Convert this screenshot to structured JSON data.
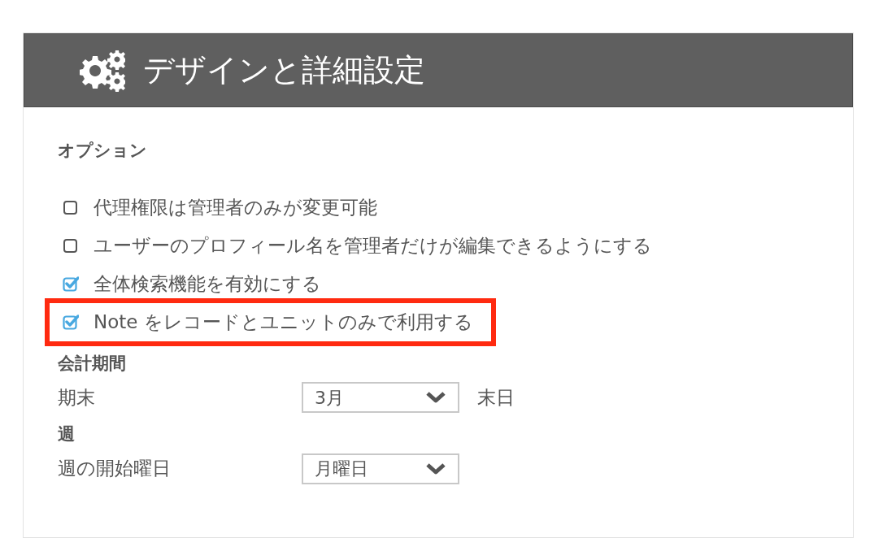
{
  "panel": {
    "title": "デザインと詳細設定"
  },
  "options_heading": "オプション",
  "options": [
    {
      "label": "代理権限は管理者のみが変更可能",
      "checked": false,
      "highlighted": false
    },
    {
      "label": "ユーザーのプロフィール名を管理者だけが編集できるようにする",
      "checked": false,
      "highlighted": false
    },
    {
      "label": "全体検索機能を有効にする",
      "checked": true,
      "highlighted": false
    },
    {
      "label": "Note をレコードとユニットのみで利用する",
      "checked": true,
      "highlighted": true
    }
  ],
  "sections": [
    {
      "heading": "会計期間",
      "rows": [
        {
          "label": "期末",
          "value": "3月",
          "suffix": "末日"
        }
      ]
    },
    {
      "heading": "週",
      "rows": [
        {
          "label": "週の開始曜日",
          "value": "月曜日"
        }
      ]
    }
  ]
}
